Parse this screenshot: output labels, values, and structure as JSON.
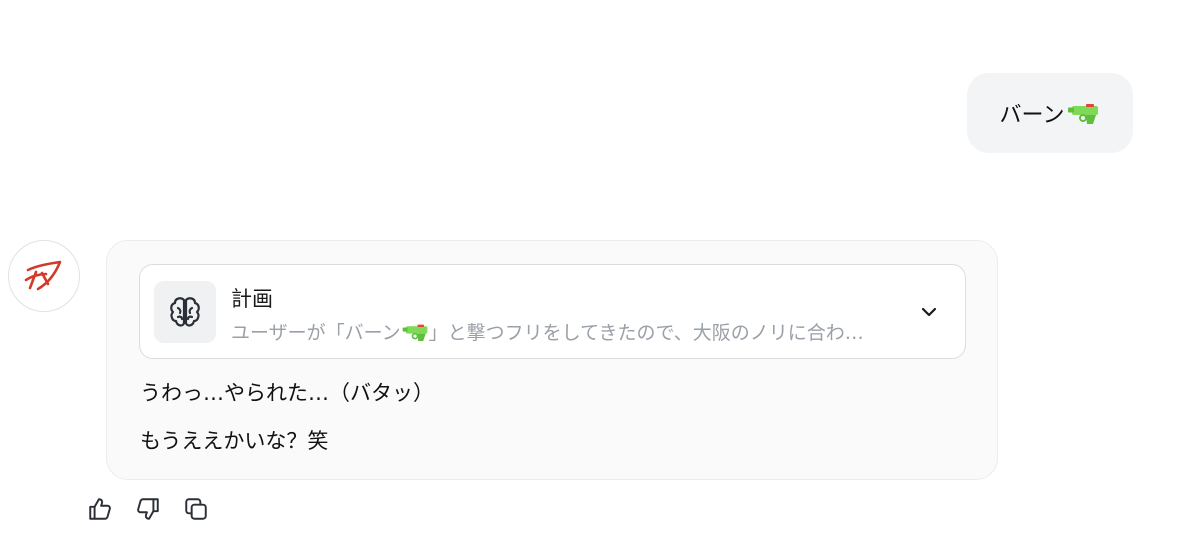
{
  "user_message": {
    "text": "バーン",
    "emoji": "water-pistol"
  },
  "assistant": {
    "avatar_icon": "app-logo-icon",
    "plan": {
      "title": "計画",
      "summary_before": "ユーザーが「バーン",
      "summary_after": "」と撃つフリをしてきたので、大阪のノリに合わ…",
      "icon": "brain-icon",
      "toggle_icon": "chevron-down-icon"
    },
    "reply_lines": [
      "うわっ…やられた…（バタッ）",
      "もうええかいな？笑"
    ]
  },
  "actions": [
    {
      "name": "thumbs-up",
      "icon": "thumbs-up-icon"
    },
    {
      "name": "thumbs-down",
      "icon": "thumbs-down-icon"
    },
    {
      "name": "copy",
      "icon": "copy-icon"
    }
  ],
  "colors": {
    "accent_logo": "#d23a2a",
    "bubble_bg": "#f3f4f6",
    "card_bg": "#fafafa",
    "muted_text": "#9aa0a8"
  }
}
